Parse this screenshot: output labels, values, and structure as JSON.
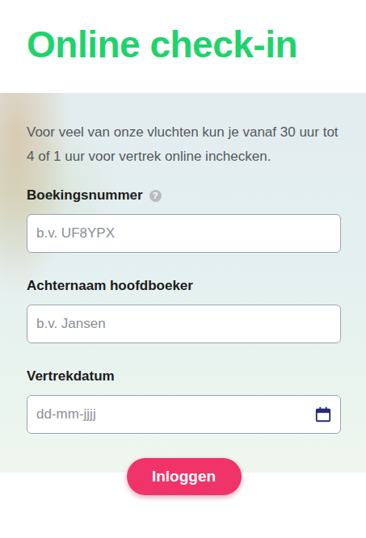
{
  "page": {
    "title": "Online check-in",
    "intro": "Voor veel van onze vluchten kun je vanaf 30 uur tot 4 of 1 uur voor vertrek online inchecken."
  },
  "fields": [
    {
      "label": "Boekingsnummer",
      "help": "?",
      "placeholder": "b.v. UF8YPX",
      "value": "",
      "kind": "text"
    },
    {
      "label": "Achternaam hoofdboeker",
      "help": "",
      "placeholder": "b.v. Jansen",
      "value": "",
      "kind": "text"
    },
    {
      "label": "Vertrekdatum",
      "help": "",
      "placeholder": "dd-mm-jjjj",
      "value": "",
      "kind": "date"
    }
  ],
  "buttons": [
    "Inloggen"
  ]
}
